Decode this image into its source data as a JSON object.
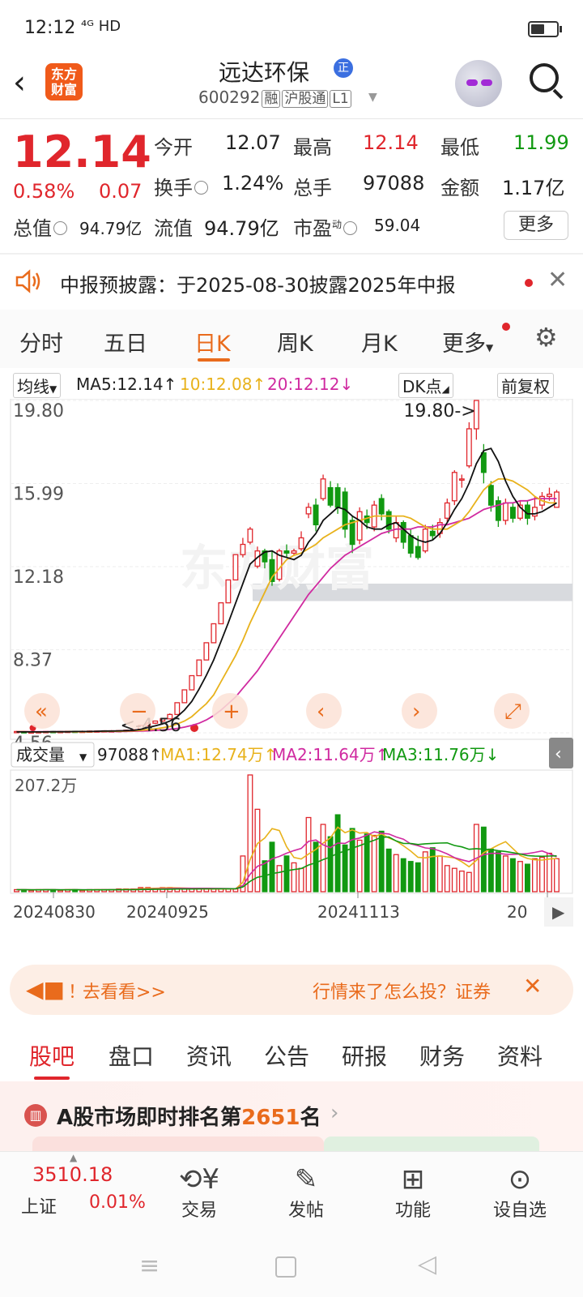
{
  "status": {
    "time": "12:12",
    "network": "⁴ᴳ HD"
  },
  "header": {
    "logo_line1": "东方",
    "logo_line2": "财富",
    "name": "远达环保",
    "badge": "正",
    "code": "600292",
    "tags": [
      "融",
      "沪股通",
      "L1"
    ]
  },
  "quote": {
    "price": "12.14",
    "pct": "0.58%",
    "change": "0.07",
    "items": [
      {
        "label": "今开",
        "value": "12.07",
        "color": "#222222"
      },
      {
        "label": "最高",
        "value": "12.14",
        "color": "#e0262c"
      },
      {
        "label": "最低",
        "value": "11.99",
        "color": "#119911"
      },
      {
        "label": "换手",
        "value": "1.24%",
        "color": "#222222"
      },
      {
        "label": "总手",
        "value": "97088",
        "color": "#222222"
      },
      {
        "label": "金额",
        "value": "1.17亿",
        "color": "#222222"
      },
      {
        "label": "总值",
        "value": "94.79亿",
        "color": "#222222"
      },
      {
        "label": "流值",
        "value": "94.79亿",
        "color": "#222222"
      },
      {
        "label": "市盈",
        "label_sup": "动",
        "value": "59.04",
        "color": "#222222"
      }
    ],
    "more": "更多"
  },
  "notice": {
    "text": "中报预披露：于2025-08-30披露2025年中报"
  },
  "tabs": [
    "分时",
    "五日",
    "日K",
    "周K",
    "月K",
    "更多"
  ],
  "indicators": {
    "ma_dropdown": "均线",
    "ma5": "MA5:12.14↑",
    "ma10": "10:12.08↑",
    "ma20": "20:12.12↓",
    "dk": "DK点",
    "fq": "前复权"
  },
  "vol_indicators": {
    "dropdown": "成交量",
    "vol": "97088↑",
    "ma1": "MA1:12.74万↑",
    "ma2": "MA2:11.64万↑",
    "ma3": "MA3:11.76万↓"
  },
  "chart_data": {
    "type": "candlestick",
    "y_ticks": [
      "19.80",
      "15.99",
      "12.18",
      "8.37",
      "4.56"
    ],
    "ylim": [
      4.56,
      19.8
    ],
    "max_label": "19.80->",
    "min_label": "<-4.56",
    "vol_label": "207.2万",
    "x_ticks": [
      "20240830",
      "20240925",
      "20241113",
      "20"
    ],
    "colors": {
      "up": "#e0262c",
      "down": "#119911",
      "ma5": "#111111",
      "ma10": "#e8b21c",
      "ma20": "#d02aa0"
    },
    "candles": [
      [
        4.6,
        4.62,
        4.58,
        4.65
      ],
      [
        4.61,
        4.6,
        4.57,
        4.64
      ],
      [
        4.6,
        4.6,
        4.56,
        4.63
      ],
      [
        4.6,
        4.61,
        4.56,
        4.62
      ],
      [
        4.6,
        4.62,
        4.58,
        4.64
      ],
      [
        4.62,
        4.61,
        4.58,
        4.64
      ],
      [
        4.6,
        4.62,
        4.59,
        4.64
      ],
      [
        4.62,
        4.63,
        4.6,
        4.65
      ],
      [
        4.63,
        4.62,
        4.6,
        4.65
      ],
      [
        4.62,
        4.63,
        4.6,
        4.66
      ],
      [
        4.63,
        4.64,
        4.61,
        4.66
      ],
      [
        4.63,
        4.64,
        4.61,
        4.66
      ],
      [
        4.64,
        4.65,
        4.62,
        4.67
      ],
      [
        4.64,
        4.65,
        4.62,
        4.68
      ],
      [
        4.65,
        4.66,
        4.63,
        4.68
      ],
      [
        4.66,
        4.68,
        4.64,
        4.7
      ],
      [
        4.68,
        4.7,
        4.66,
        4.72
      ],
      [
        4.69,
        4.9,
        4.68,
        4.92
      ],
      [
        4.9,
        5.0,
        4.85,
        5.05
      ],
      [
        5.0,
        5.1,
        4.96,
        5.12
      ],
      [
        5.1,
        5.2,
        5.06,
        5.24
      ],
      [
        5.2,
        5.4,
        5.18,
        5.45
      ],
      [
        5.4,
        5.94,
        5.4,
        5.94
      ],
      [
        5.94,
        6.53,
        5.94,
        6.53
      ],
      [
        6.53,
        7.18,
        6.53,
        7.18
      ],
      [
        7.18,
        7.9,
        7.18,
        7.9
      ],
      [
        7.9,
        8.69,
        7.9,
        8.69
      ],
      [
        8.69,
        9.56,
        8.69,
        9.56
      ],
      [
        9.56,
        10.52,
        9.56,
        10.52
      ],
      [
        10.52,
        11.57,
        10.52,
        11.57
      ],
      [
        11.57,
        12.73,
        11.57,
        12.73
      ],
      [
        12.73,
        13.2,
        12.6,
        13.5
      ],
      [
        13.3,
        13.9,
        13.2,
        14.0
      ],
      [
        12.2,
        12.9,
        12.1,
        13.1
      ],
      [
        12.9,
        12.4,
        12.1,
        13.0
      ],
      [
        12.5,
        11.5,
        11.3,
        12.9
      ],
      [
        11.6,
        12.9,
        11.5,
        13.0
      ],
      [
        12.9,
        12.8,
        12.6,
        13.2
      ],
      [
        12.8,
        12.9,
        12.7,
        13.0
      ],
      [
        13.0,
        13.5,
        12.9,
        13.8
      ],
      [
        14.6,
        14.9,
        14.4,
        15.1
      ],
      [
        15.0,
        14.1,
        13.8,
        15.3
      ],
      [
        15.3,
        16.2,
        15.2,
        16.4
      ],
      [
        15.8,
        15.0,
        14.9,
        16.1
      ],
      [
        15.8,
        14.9,
        14.6,
        16.0
      ],
      [
        15.6,
        13.9,
        13.5,
        15.8
      ],
      [
        14.3,
        13.2,
        12.8,
        14.5
      ],
      [
        13.4,
        14.7,
        13.2,
        14.9
      ],
      [
        14.5,
        14.2,
        13.9,
        14.8
      ],
      [
        14.0,
        15.0,
        13.8,
        15.2
      ],
      [
        15.3,
        14.6,
        14.3,
        15.5
      ],
      [
        14.7,
        13.9,
        13.7,
        14.8
      ],
      [
        13.5,
        14.2,
        13.3,
        14.5
      ],
      [
        14.2,
        13.3,
        13.0,
        14.3
      ],
      [
        13.6,
        12.8,
        12.6,
        13.9
      ],
      [
        13.1,
        12.6,
        12.5,
        13.6
      ],
      [
        12.9,
        13.9,
        12.8,
        14.1
      ],
      [
        13.8,
        13.6,
        13.4,
        14.1
      ],
      [
        13.7,
        14.2,
        13.5,
        14.4
      ],
      [
        14.4,
        15.1,
        14.2,
        15.3
      ],
      [
        15.2,
        16.5,
        15.0,
        16.6
      ],
      [
        16.2,
        16.2,
        15.8,
        16.4
      ],
      [
        16.8,
        18.5,
        16.7,
        18.8
      ],
      [
        18.5,
        19.8,
        18.0,
        19.8
      ],
      [
        17.4,
        16.5,
        16.0,
        17.8
      ],
      [
        15.9,
        15.0,
        14.7,
        16.1
      ],
      [
        15.2,
        14.3,
        14.0,
        15.4
      ],
      [
        14.3,
        15.1,
        14.1,
        15.3
      ],
      [
        14.9,
        14.4,
        14.2,
        15.1
      ],
      [
        14.4,
        15.0,
        14.3,
        15.2
      ],
      [
        15.0,
        14.4,
        14.1,
        15.2
      ],
      [
        14.5,
        14.9,
        14.3,
        15.4
      ],
      [
        15.0,
        15.4,
        14.8,
        15.6
      ],
      [
        15.4,
        15.5,
        15.2,
        15.8
      ],
      [
        14.9,
        15.6,
        14.9,
        15.7
      ]
    ],
    "volumes": [
      3,
      3,
      2,
      3,
      3,
      3,
      2,
      3,
      3,
      2,
      3,
      3,
      3,
      3,
      4,
      4,
      4,
      6,
      6,
      5,
      6,
      6,
      5,
      4,
      4,
      4,
      4,
      4,
      4,
      4,
      4,
      52,
      170,
      120,
      45,
      72,
      38,
      52,
      42,
      34,
      108,
      72,
      98,
      80,
      112,
      68,
      92,
      75,
      84,
      82,
      88,
      62,
      54,
      48,
      44,
      42,
      58,
      64,
      52,
      38,
      34,
      30,
      28,
      98,
      94,
      62,
      58,
      52,
      48,
      44,
      40,
      48,
      50,
      56,
      48
    ],
    "ma5": [
      4.6,
      4.6,
      4.6,
      4.6,
      4.6,
      4.61,
      4.61,
      4.61,
      4.62,
      4.62,
      4.62,
      4.63,
      4.64,
      4.64,
      4.65,
      4.66,
      4.67,
      4.72,
      4.8,
      4.88,
      4.97,
      5.1,
      5.3,
      5.6,
      6.0,
      6.56,
      7.2,
      7.9,
      8.75,
      9.6,
      10.5,
      11.4,
      12.3,
      12.6,
      12.85,
      12.9,
      12.7,
      12.6,
      12.5,
      12.7,
      13.3,
      13.7,
      14.3,
      14.6,
      14.9,
      14.8,
      14.5,
      14.3,
      14.0,
      13.9,
      13.9,
      14.1,
      14.2,
      13.9,
      13.6,
      13.4,
      13.3,
      13.4,
      13.7,
      14.2,
      14.8,
      15.3,
      16.0,
      16.9,
      17.5,
      17.6,
      17.0,
      16.1,
      15.4,
      14.9,
      14.6,
      14.6,
      14.7,
      14.9,
      15.1
    ],
    "ma10": [
      4.61,
      4.61,
      4.6,
      4.6,
      4.6,
      4.6,
      4.6,
      4.61,
      4.61,
      4.61,
      4.61,
      4.62,
      4.62,
      4.63,
      4.63,
      4.64,
      4.65,
      4.67,
      4.7,
      4.74,
      4.79,
      4.85,
      4.96,
      5.1,
      5.3,
      5.6,
      5.9,
      6.3,
      6.9,
      7.5,
      8.1,
      8.8,
      9.6,
      10.3,
      11.0,
      11.7,
      12.1,
      12.5,
      12.7,
      12.8,
      13.0,
      13.2,
      13.5,
      13.7,
      13.9,
      14.1,
      14.2,
      14.3,
      14.4,
      14.5,
      14.5,
      14.5,
      14.5,
      14.5,
      14.4,
      14.2,
      14.0,
      13.9,
      13.9,
      13.9,
      14.1,
      14.3,
      14.7,
      15.2,
      15.7,
      16.0,
      16.2,
      16.2,
      16.1,
      15.9,
      15.7,
      15.4,
      15.2,
      15.1,
      15.1
    ],
    "ma20": [
      4.62,
      4.62,
      4.61,
      4.61,
      4.61,
      4.61,
      4.61,
      4.61,
      4.61,
      4.61,
      4.61,
      4.61,
      4.61,
      4.62,
      4.62,
      4.62,
      4.63,
      4.64,
      4.65,
      4.67,
      4.69,
      4.72,
      4.76,
      4.82,
      4.9,
      5.0,
      5.15,
      5.35,
      5.6,
      5.9,
      6.2,
      6.6,
      7.0,
      7.4,
      7.9,
      8.4,
      8.9,
      9.4,
      9.9,
      10.4,
      10.9,
      11.3,
      11.7,
      12.1,
      12.4,
      12.7,
      12.9,
      13.1,
      13.3,
      13.5,
      13.7,
      13.8,
      13.9,
      13.9,
      13.9,
      14.0,
      14.0,
      14.0,
      14.1,
      14.1,
      14.2,
      14.3,
      14.4,
      14.6,
      14.8,
      14.9,
      15.0,
      15.1,
      15.1,
      15.2,
      15.2,
      15.3,
      15.3,
      15.3,
      15.3
    ],
    "shaded_band": [
      10.6,
      11.4
    ]
  },
  "ad": {
    "warn": "！",
    "left": "去看看>>",
    "right": "行情来了怎么投？证券"
  },
  "bottom_tabs": [
    "股吧",
    "盘口",
    "资讯",
    "公告",
    "研报",
    "财务",
    "资料"
  ],
  "ranking": {
    "prefix": "A股市场即时排名第",
    "rank": "2651",
    "suffix": "名"
  },
  "nav": {
    "index_value": "3510.18",
    "index_name": "上证",
    "index_pct": "0.01%",
    "items": [
      {
        "label": "交易",
        "icon": "trade-icon"
      },
      {
        "label": "发帖",
        "icon": "post-icon"
      },
      {
        "label": "功能",
        "icon": "grid-icon"
      },
      {
        "label": "设自选",
        "icon": "add-watchlist-icon"
      }
    ]
  }
}
